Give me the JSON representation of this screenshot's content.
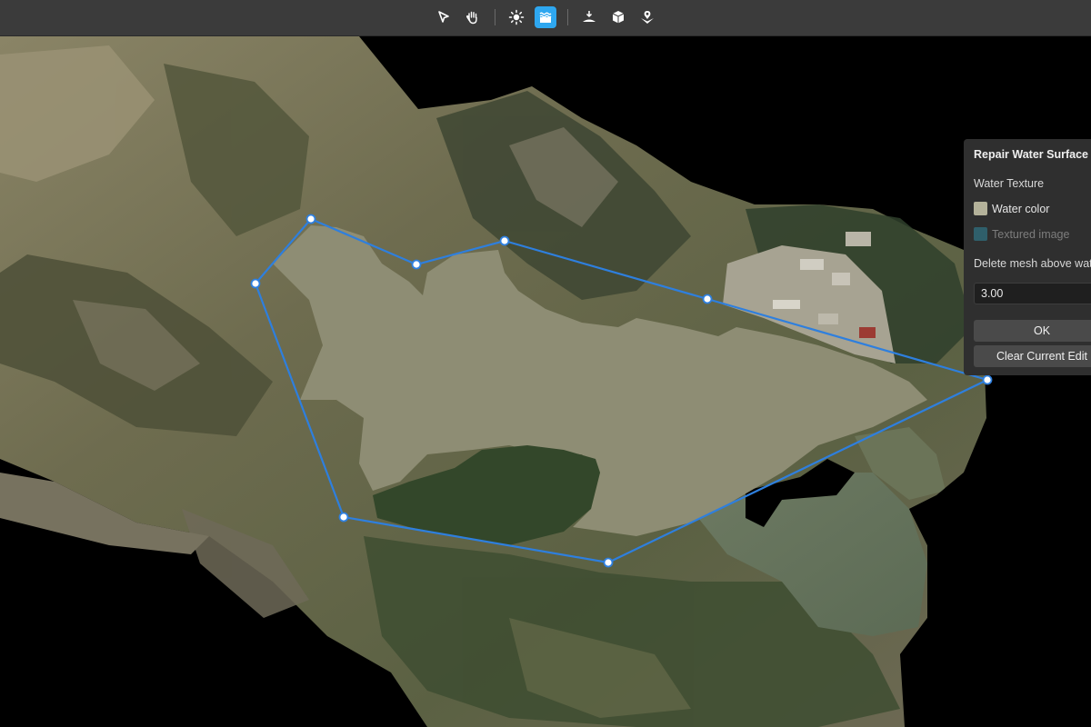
{
  "toolbar": {
    "tools": [
      {
        "id": "select",
        "icon": "cursor-arrow-icon",
        "active": false
      },
      {
        "id": "pan",
        "icon": "hand-icon",
        "active": false
      },
      {
        "id": "lighting",
        "icon": "sun-icon",
        "active": false
      },
      {
        "id": "water",
        "icon": "water-surface-icon",
        "active": true
      },
      {
        "id": "flatten",
        "icon": "flatten-terrain-icon",
        "active": false
      },
      {
        "id": "model",
        "icon": "cube-icon",
        "active": false
      },
      {
        "id": "patch",
        "icon": "patch-hole-icon",
        "active": false
      }
    ]
  },
  "panel": {
    "title": "Repair Water Surface",
    "water_texture_label": "Water Texture",
    "option_color": "Water color",
    "option_image": "Textured image",
    "delete_label": "Delete mesh above water",
    "height_value": "3.00",
    "ok_label": "OK",
    "clear_label": "Clear Current Edit"
  },
  "colors": {
    "water_fill": "#8e8d74",
    "polygon_line": "#2e7fde",
    "accent": "#2ea7f0",
    "panel_bg": "#2f2f2f"
  }
}
